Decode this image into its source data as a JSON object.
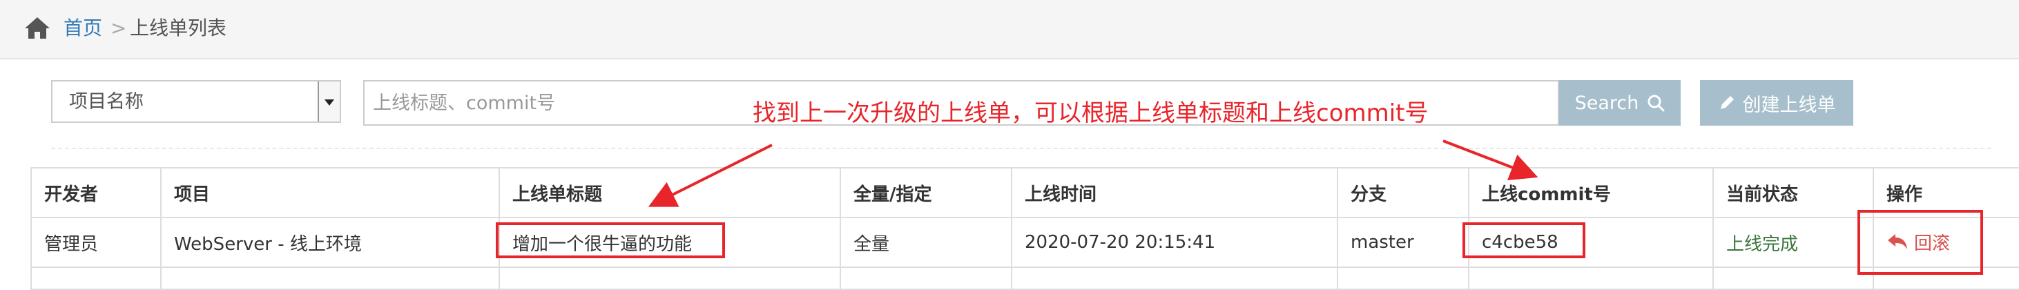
{
  "breadcrumb": {
    "home": "首页",
    "separator": ">",
    "current": "上线单列表"
  },
  "toolbar": {
    "project_placeholder": "项目名称",
    "search_placeholder": "上线标题、commit号",
    "search_label": "Search",
    "create_label": "创建上线单"
  },
  "table": {
    "headers": [
      "开发者",
      "项目",
      "上线单标题",
      "全量/指定",
      "上线时间",
      "分支",
      "上线commit号",
      "当前状态",
      "操作"
    ],
    "rows": [
      {
        "developer": "管理员",
        "project": "WebServer - 线上环境",
        "title": "增加一个很牛逼的功能",
        "scope": "全量",
        "time": "2020-07-20 20:15:41",
        "branch": "master",
        "commit": "c4cbe58",
        "status": "上线完成",
        "action": "回滚"
      }
    ]
  },
  "annotation": {
    "text": "找到上一次升级的上线单，可以根据上线单标题和上线commit号"
  },
  "colors": {
    "link": "#337ab7",
    "button": "#a7bfcc",
    "annotation": "#e8252a",
    "status_done": "#3c763d",
    "rollback": "#d9534f"
  },
  "icons": [
    "home-icon",
    "search-icon",
    "pencil-icon",
    "reply-icon"
  ]
}
